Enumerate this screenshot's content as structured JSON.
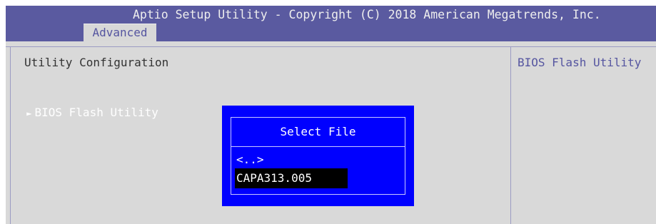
{
  "window": {
    "title": "Aptio Setup Utility - Copyright (C) 2018 American Megatrends, Inc."
  },
  "tabs": [
    {
      "label": "Advanced",
      "active": true
    }
  ],
  "main": {
    "section_title": "Utility Configuration",
    "items": [
      {
        "label": "BIOS Flash Utility",
        "has_submenu": true,
        "arrow_icon": "right-triangle-icon"
      }
    ]
  },
  "help_panel": {
    "text": "BIOS Flash Utility"
  },
  "dialog": {
    "title": "Select File",
    "entries": [
      {
        "label": "<..>",
        "selected": false
      },
      {
        "label": "CAPA313.005",
        "selected": true
      }
    ]
  },
  "colors": {
    "title_bar": "#5a5aa0",
    "background": "#d9d9d9",
    "dialog": "#0000ff",
    "selection": "#000000",
    "help_text": "#5555a0",
    "menu_item_text": "#ffffff"
  }
}
